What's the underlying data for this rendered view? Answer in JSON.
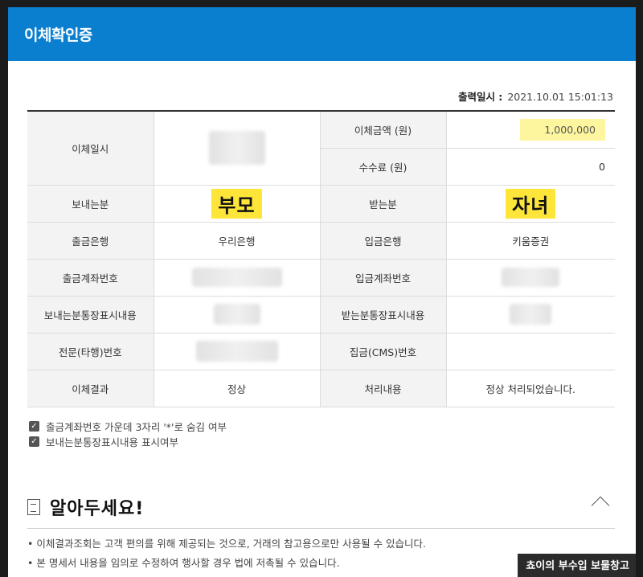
{
  "header": {
    "title": "이체확인증"
  },
  "print": {
    "label": "출력일시 :",
    "value": "2021.10.01 15:01:13"
  },
  "table": {
    "transfer_date_label": "이체일시",
    "amount_label": "이체금액 (원)",
    "amount_value": "1,000,000",
    "fee_label": "수수료 (원)",
    "fee_value": "0",
    "sender_label": "보내는분",
    "sender_value": "부모",
    "receiver_label": "받는분",
    "receiver_value": "자녀",
    "out_bank_label": "출금은행",
    "out_bank_value": "우리은행",
    "in_bank_label": "입금은행",
    "in_bank_value": "키움증권",
    "out_account_label": "출금계좌번호",
    "in_account_label": "입금계좌번호",
    "sender_memo_label": "보내는분통장표시내용",
    "receiver_memo_label": "받는분통장표시내용",
    "telegram_label": "전문(타행)번호",
    "cms_label": "집금(CMS)번호",
    "result_label": "이체결과",
    "result_value": "정상",
    "process_label": "처리내용",
    "process_value": "정상 처리되었습니다."
  },
  "checks": [
    {
      "label": "출금계좌번호 가운데 3자리 '*'로 숨김 여부",
      "checked": true
    },
    {
      "label": "보내는분통장표시내용 표시여부",
      "checked": true
    }
  ],
  "notice": {
    "title": "알아두세요!",
    "items": [
      "• 이체결과조회는 고객 편의를 위해 제공되는 것으로, 거래의 참고용으로만 사용될 수 있습니다.",
      "• 본 명세서 내용을 임의로 수정하여 행사할 경우 법에 저촉될 수 있습니다."
    ]
  },
  "watermark": "쵸이의 부수입 보물창고"
}
